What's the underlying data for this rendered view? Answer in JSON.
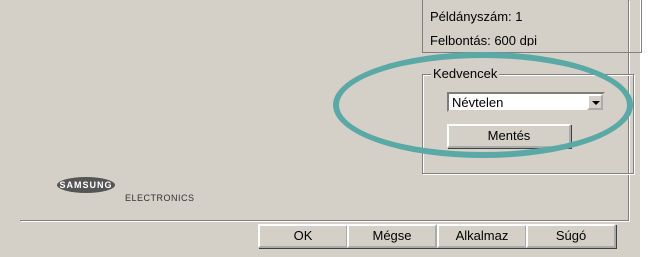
{
  "info": {
    "copies": "Példányszám: 1",
    "resolution": "Felbontás: 600 dpi"
  },
  "favorites": {
    "group_title": "Kedvencek",
    "selected": "Névtelen",
    "save_label": "Mentés"
  },
  "logo": {
    "brand": "SAMSUNG",
    "sub": "ELECTRONICS"
  },
  "footer": {
    "ok": "OK",
    "cancel": "Mégse",
    "apply": "Alkalmaz",
    "help": "Súgó"
  },
  "colors": {
    "dialog_bg": "#d4d0c8",
    "highlight": "#5aa9a6"
  },
  "icons": {
    "dropdown": "chevron-down-icon"
  }
}
